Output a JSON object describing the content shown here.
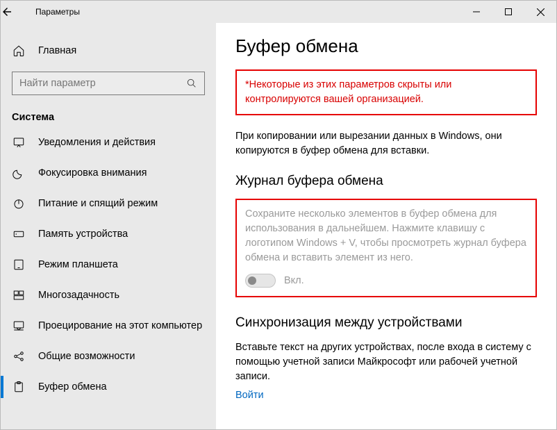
{
  "window": {
    "title": "Параметры"
  },
  "sidebar": {
    "home": "Главная",
    "search_placeholder": "Найти параметр",
    "category": "Система",
    "items": [
      {
        "label": "Уведомления и действия"
      },
      {
        "label": "Фокусировка внимания"
      },
      {
        "label": "Питание и спящий режим"
      },
      {
        "label": "Память устройства"
      },
      {
        "label": "Режим планшета"
      },
      {
        "label": "Многозадачность"
      },
      {
        "label": "Проецирование на этот компьютер"
      },
      {
        "label": "Общие возможности"
      },
      {
        "label": "Буфер обмена"
      }
    ]
  },
  "main": {
    "title": "Буфер обмена",
    "notice": "*Некоторые из этих параметров скрыты или контролируются вашей организацией.",
    "intro": "При копировании или вырезании данных в Windows, они копируются в буфер обмена для вставки.",
    "history": {
      "heading": "Журнал буфера обмена",
      "desc": "Сохраните несколько элементов в буфер обмена для использования в дальнейшем. Нажмите клавишу с логотипом Windows + V, чтобы просмотреть журнал буфера обмена и вставить элемент из него.",
      "toggle_label": "Вкл."
    },
    "sync": {
      "heading": "Синхронизация между устройствами",
      "desc": "Вставьте текст на других устройствах, после входа в систему с помощью учетной записи Майкрософт или рабочей учетной записи.",
      "link": "Войти"
    }
  }
}
